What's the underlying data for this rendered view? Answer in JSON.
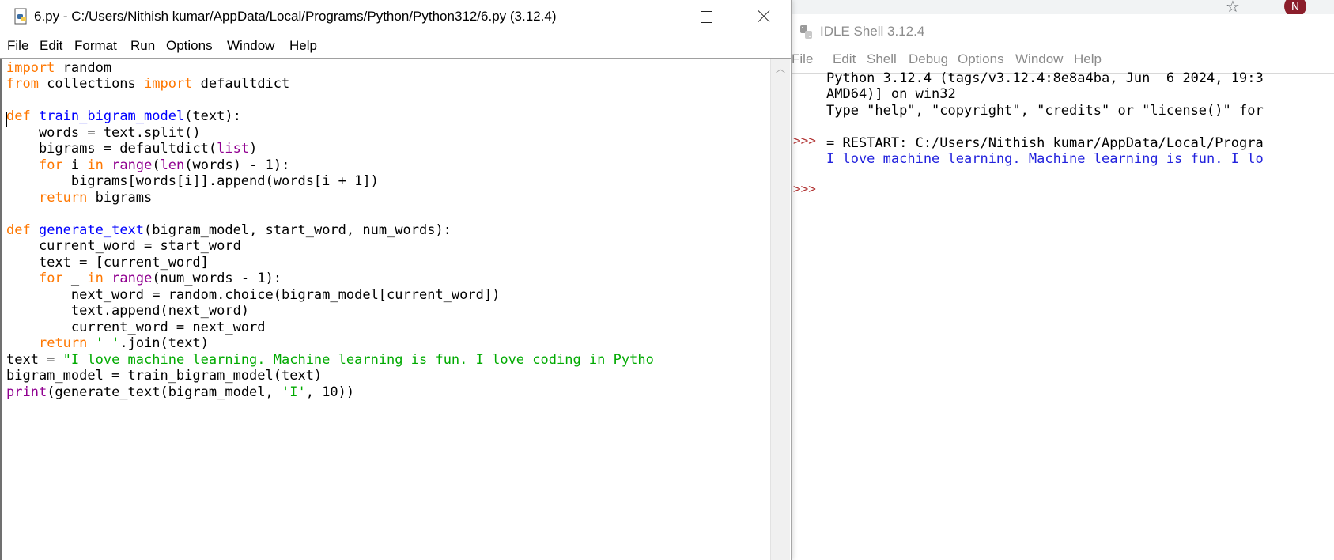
{
  "background": {
    "avatar_initial": "N",
    "star_icon": "star-icon"
  },
  "editor": {
    "title": "6.py - C:/Users/Nithish kumar/AppData/Local/Programs/Python/Python312/6.py (3.12.4)",
    "menu": [
      "File",
      "Edit",
      "Format",
      "Run",
      "Options",
      "Window",
      "Help"
    ],
    "code_lines": [
      [
        {
          "t": "import",
          "c": "kw"
        },
        {
          "t": " random"
        }
      ],
      [
        {
          "t": "from",
          "c": "kw"
        },
        {
          "t": " collections "
        },
        {
          "t": "import",
          "c": "kw"
        },
        {
          "t": " defaultdict"
        }
      ],
      [],
      [
        {
          "t": "def",
          "c": "kw"
        },
        {
          "t": " "
        },
        {
          "t": "train_bigram_model",
          "c": "fn"
        },
        {
          "t": "(text):"
        }
      ],
      [
        {
          "t": "    words = text.split()"
        }
      ],
      [
        {
          "t": "    bigrams = defaultdict("
        },
        {
          "t": "list",
          "c": "bi"
        },
        {
          "t": ")"
        }
      ],
      [
        {
          "t": "    "
        },
        {
          "t": "for",
          "c": "kw"
        },
        {
          "t": " i "
        },
        {
          "t": "in",
          "c": "kw"
        },
        {
          "t": " "
        },
        {
          "t": "range",
          "c": "bi"
        },
        {
          "t": "("
        },
        {
          "t": "len",
          "c": "bi"
        },
        {
          "t": "(words) - 1):"
        }
      ],
      [
        {
          "t": "        bigrams[words[i]].append(words[i + 1])"
        }
      ],
      [
        {
          "t": "    "
        },
        {
          "t": "return",
          "c": "kw"
        },
        {
          "t": " bigrams"
        }
      ],
      [],
      [
        {
          "t": "def",
          "c": "kw"
        },
        {
          "t": " "
        },
        {
          "t": "generate_text",
          "c": "fn"
        },
        {
          "t": "(bigram_model, start_word, num_words):"
        }
      ],
      [
        {
          "t": "    current_word = start_word"
        }
      ],
      [
        {
          "t": "    text = [current_word]"
        }
      ],
      [
        {
          "t": "    "
        },
        {
          "t": "for",
          "c": "kw"
        },
        {
          "t": " _ "
        },
        {
          "t": "in",
          "c": "kw"
        },
        {
          "t": " "
        },
        {
          "t": "range",
          "c": "bi"
        },
        {
          "t": "(num_words - 1):"
        }
      ],
      [
        {
          "t": "        next_word = random.choice(bigram_model[current_word])"
        }
      ],
      [
        {
          "t": "        text.append(next_word)"
        }
      ],
      [
        {
          "t": "        current_word = next_word"
        }
      ],
      [
        {
          "t": "    "
        },
        {
          "t": "return",
          "c": "kw"
        },
        {
          "t": " "
        },
        {
          "t": "' '",
          "c": "str"
        },
        {
          "t": ".join(text)"
        }
      ],
      [
        {
          "t": "text = "
        },
        {
          "t": "\"I love machine learning. Machine learning is fun. I love coding in Pytho",
          "c": "str"
        }
      ],
      [
        {
          "t": "bigram_model = train_bigram_model(text)"
        }
      ],
      [
        {
          "t": "print",
          "c": "bi"
        },
        {
          "t": "(generate_text(bigram_model, "
        },
        {
          "t": "'I'",
          "c": "str"
        },
        {
          "t": ", 10))"
        }
      ]
    ]
  },
  "shell": {
    "title": "IDLE Shell 3.12.4",
    "menu": [
      "File",
      "Edit",
      "Shell",
      "Debug",
      "Options",
      "Window",
      "Help"
    ],
    "prompt": ">>>",
    "lines": [
      {
        "text": "Python 3.12.4 (tags/v3.12.4:8e8a4ba, Jun  6 2024, 19:3",
        "color": "black"
      },
      {
        "text": "AMD64)] on win32",
        "color": "black"
      },
      {
        "text": "Type \"help\", \"copyright\", \"credits\" or \"license()\" for",
        "color": "black"
      },
      {
        "text": "",
        "color": "black"
      },
      {
        "text": "= RESTART: C:/Users/Nithish kumar/AppData/Local/Progra",
        "color": "black"
      },
      {
        "text": "I love machine learning. Machine learning is fun. I lo",
        "color": "blue"
      }
    ]
  }
}
